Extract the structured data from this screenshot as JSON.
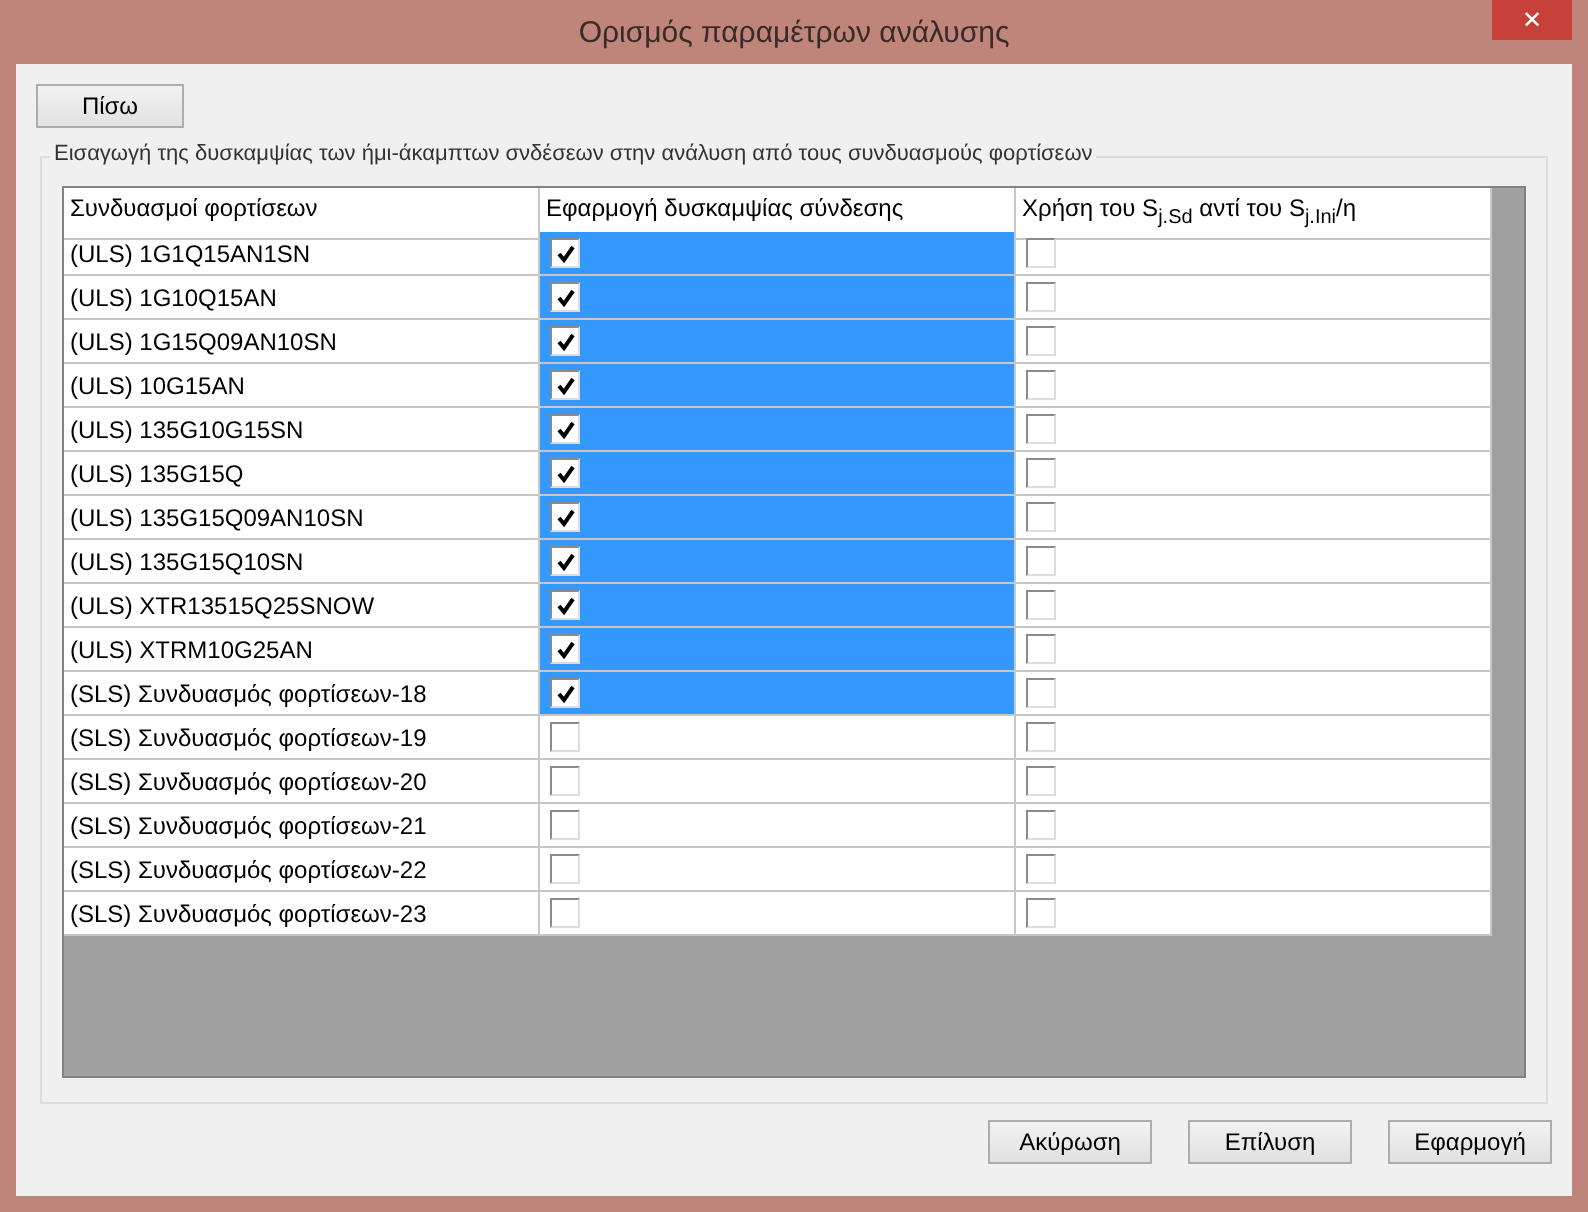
{
  "window": {
    "title": "Ορισμός παραμέτρων ανάλυσης",
    "close": "✕"
  },
  "back_button": "Πίσω",
  "group": {
    "legend": "Εισαγωγή της δυσκαμψίας των ήμι-άκαμπτων σνδέσεων στην ανάλυση από τους συνδυασμούς φορτίσεων"
  },
  "table": {
    "columns": [
      "Συνδυασμοί φορτίσεων",
      "Εφαρμογή δυσκαμψίας σύνδεσης",
      "Χρήση του S$_{j.Sd}$ αντί του S$_{j.Ini}$/η"
    ],
    "rows": [
      {
        "name": "(ULS) 1G1Q15AN1SN",
        "apply": true,
        "use_sjsd": false
      },
      {
        "name": "(ULS) 1G10Q15AN",
        "apply": true,
        "use_sjsd": false
      },
      {
        "name": "(ULS) 1G15Q09AN10SN",
        "apply": true,
        "use_sjsd": false
      },
      {
        "name": "(ULS) 10G15AN",
        "apply": true,
        "use_sjsd": false
      },
      {
        "name": "(ULS) 135G10G15SN",
        "apply": true,
        "use_sjsd": false
      },
      {
        "name": "(ULS) 135G15Q",
        "apply": true,
        "use_sjsd": false
      },
      {
        "name": "(ULS) 135G15Q09AN10SN",
        "apply": true,
        "use_sjsd": false
      },
      {
        "name": "(ULS) 135G15Q10SN",
        "apply": true,
        "use_sjsd": false
      },
      {
        "name": "(ULS) XTR13515Q25SNOW",
        "apply": true,
        "use_sjsd": false
      },
      {
        "name": "(ULS) XTRM10G25AN",
        "apply": true,
        "use_sjsd": false
      },
      {
        "name": "(SLS) Συνδυασμός φορτίσεων-18",
        "apply": true,
        "use_sjsd": false
      },
      {
        "name": "(SLS) Συνδυασμός φορτίσεων-19",
        "apply": false,
        "use_sjsd": false
      },
      {
        "name": "(SLS) Συνδυασμός φορτίσεων-20",
        "apply": false,
        "use_sjsd": false
      },
      {
        "name": "(SLS) Συνδυασμός φορτίσεων-21",
        "apply": false,
        "use_sjsd": false
      },
      {
        "name": "(SLS) Συνδυασμός φορτίσεων-22",
        "apply": false,
        "use_sjsd": false
      },
      {
        "name": "(SLS) Συνδυασμός φορτίσεων-23",
        "apply": false,
        "use_sjsd": false
      }
    ]
  },
  "buttons": [
    "Ακύρωση",
    "Επίλυση",
    "Εφαρμογή"
  ]
}
